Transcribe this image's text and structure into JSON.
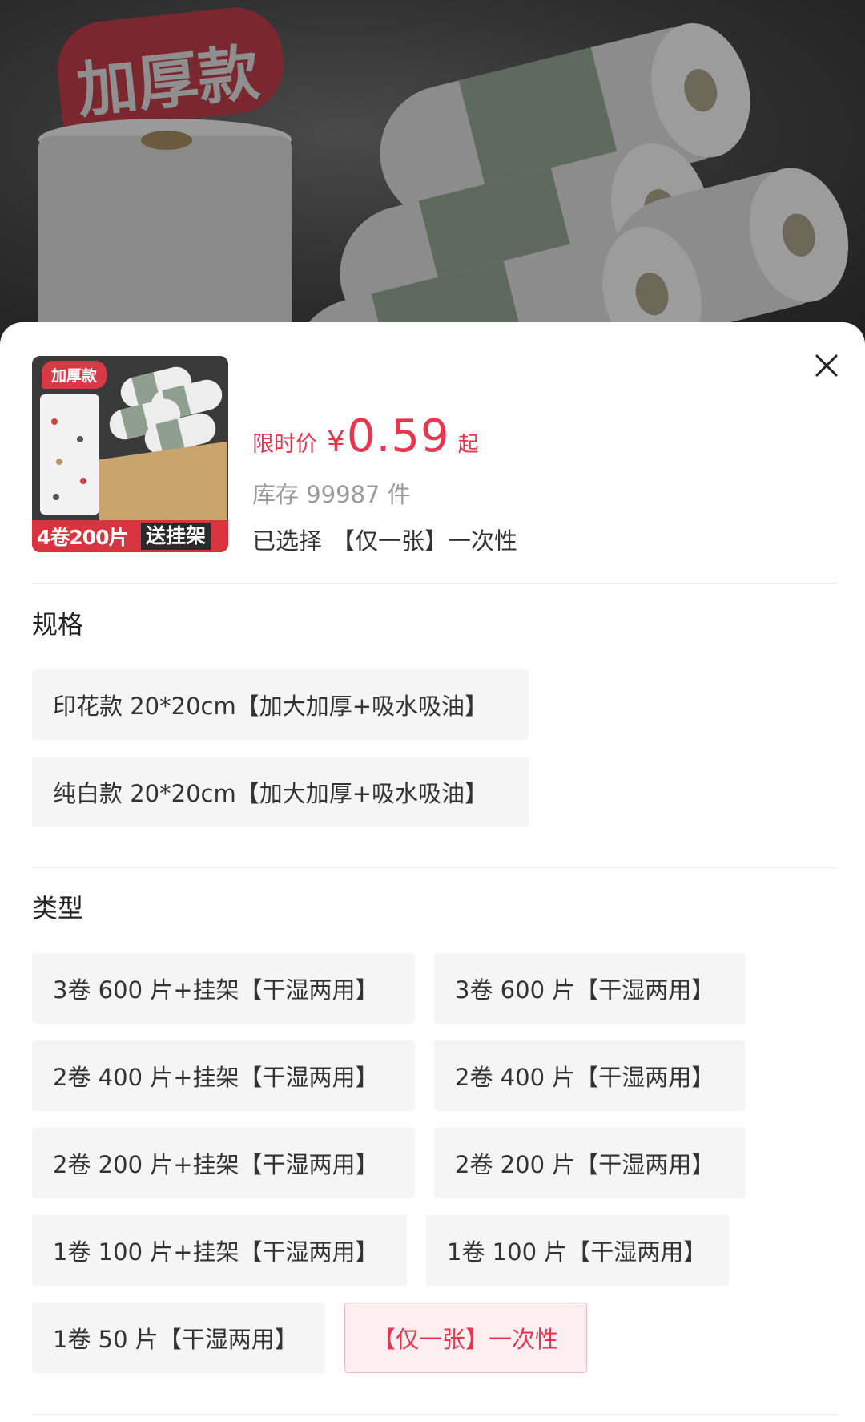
{
  "background": {
    "badge_text": "加厚款"
  },
  "product": {
    "thumb_tag": "加厚款",
    "thumb_banner_left": "4卷200片",
    "thumb_banner_right": "送挂架",
    "price_label": "限时价",
    "price_currency": "¥",
    "price_amount": "0.59",
    "price_suffix": "起",
    "stock_text": "库存 99987 件",
    "selected_label": "已选择",
    "selected_value": "【仅一张】一次性"
  },
  "spec": {
    "title": "规格",
    "options": [
      "印花款 20*20cm【加大加厚+吸水吸油】",
      "纯白款 20*20cm【加大加厚+吸水吸油】"
    ]
  },
  "type": {
    "title": "类型",
    "options": [
      "3卷 600 片+挂架【干湿两用】",
      "3卷 600 片【干湿两用】",
      "2卷 400 片+挂架【干湿两用】",
      "2卷 400 片【干湿两用】",
      "2卷 200 片+挂架【干湿两用】",
      "2卷 200 片【干湿两用】",
      "1卷 100 片+挂架【干湿两用】",
      "1卷 100 片【干湿两用】",
      "1卷 50 片【干湿两用】",
      "【仅一张】一次性"
    ],
    "selected_option": "【仅一张】一次性"
  },
  "colors": {
    "accent": "#e8364f",
    "selected_bg": "#fdeff1",
    "option_bg": "#f5f5f5"
  }
}
